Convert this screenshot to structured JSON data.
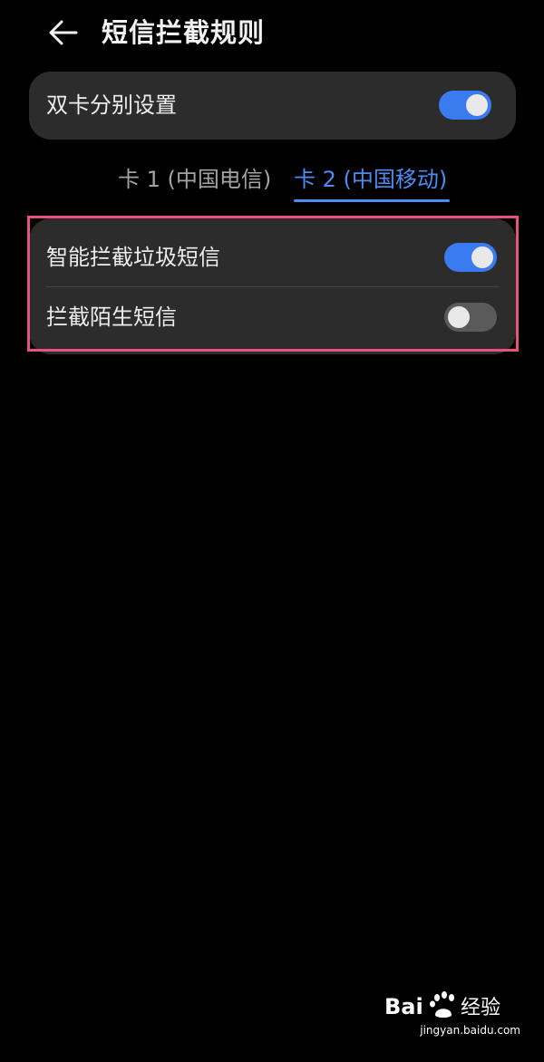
{
  "header": {
    "title": "短信拦截规则",
    "back_icon": "arrow-left-icon"
  },
  "dual_card": {
    "label": "双卡分别设置",
    "enabled": true
  },
  "tabs": [
    {
      "label": "卡 1 (中国电信)",
      "selected": false
    },
    {
      "label": "卡 2 (中国移动)",
      "selected": true
    }
  ],
  "rules": [
    {
      "label": "智能拦截垃圾短信",
      "enabled": true
    },
    {
      "label": "拦截陌生短信",
      "enabled": false
    }
  ],
  "colors": {
    "background": "#000000",
    "card": "#2c2c2c",
    "accent": "#3a7bef",
    "tab_active": "#4d8cf5",
    "highlight": "#e8527e",
    "toggle_off": "#5a5a5a"
  },
  "watermark": {
    "logo_text": "Bai 经验",
    "url": "jingyan.baidu.com"
  }
}
